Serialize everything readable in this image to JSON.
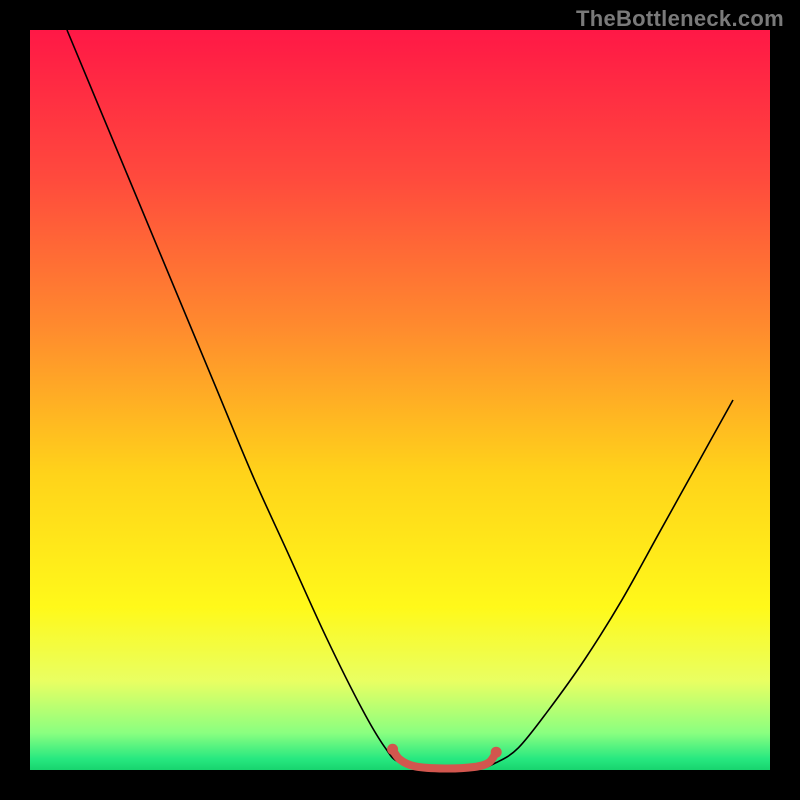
{
  "watermark": "TheBottleneck.com",
  "chart_data": {
    "type": "line",
    "title": "",
    "xlabel": "",
    "ylabel": "",
    "xlim": [
      0,
      100
    ],
    "ylim": [
      0,
      100
    ],
    "plot_background": {
      "type": "vertical_gradient",
      "stops": [
        {
          "pct": 0.0,
          "approx_color": "#ff1846"
        },
        {
          "pct": 0.2,
          "approx_color": "#ff4a3d"
        },
        {
          "pct": 0.4,
          "approx_color": "#ff8a2e"
        },
        {
          "pct": 0.6,
          "approx_color": "#ffd31a"
        },
        {
          "pct": 0.78,
          "approx_color": "#fff91a"
        },
        {
          "pct": 0.88,
          "approx_color": "#e9ff62"
        },
        {
          "pct": 0.95,
          "approx_color": "#8aff80"
        },
        {
          "pct": 0.985,
          "approx_color": "#27e880"
        },
        {
          "pct": 1.0,
          "approx_color": "#18d46e"
        }
      ]
    },
    "series": [
      {
        "name": "bottleneck-curve",
        "stroke": "#000000",
        "stroke_width": 1.2,
        "points": [
          {
            "x": 5,
            "y": 100
          },
          {
            "x": 10,
            "y": 88
          },
          {
            "x": 15,
            "y": 76
          },
          {
            "x": 20,
            "y": 64
          },
          {
            "x": 25,
            "y": 52
          },
          {
            "x": 30,
            "y": 40
          },
          {
            "x": 35,
            "y": 29
          },
          {
            "x": 40,
            "y": 18
          },
          {
            "x": 45,
            "y": 8
          },
          {
            "x": 48,
            "y": 3
          },
          {
            "x": 50,
            "y": 1
          },
          {
            "x": 55,
            "y": 0
          },
          {
            "x": 60,
            "y": 0
          },
          {
            "x": 63,
            "y": 1
          },
          {
            "x": 66,
            "y": 3
          },
          {
            "x": 70,
            "y": 8
          },
          {
            "x": 75,
            "y": 15
          },
          {
            "x": 80,
            "y": 23
          },
          {
            "x": 85,
            "y": 32
          },
          {
            "x": 90,
            "y": 41
          },
          {
            "x": 95,
            "y": 50
          }
        ]
      },
      {
        "name": "optimal-zone-marker",
        "stroke": "#d2564e",
        "stroke_width": 7,
        "points": [
          {
            "x": 49,
            "y": 2.8
          },
          {
            "x": 50,
            "y": 1.4
          },
          {
            "x": 52,
            "y": 0.5
          },
          {
            "x": 56,
            "y": 0.2
          },
          {
            "x": 60,
            "y": 0.4
          },
          {
            "x": 62,
            "y": 1.0
          },
          {
            "x": 63,
            "y": 2.4
          }
        ],
        "endpoint_markers": true
      }
    ]
  }
}
